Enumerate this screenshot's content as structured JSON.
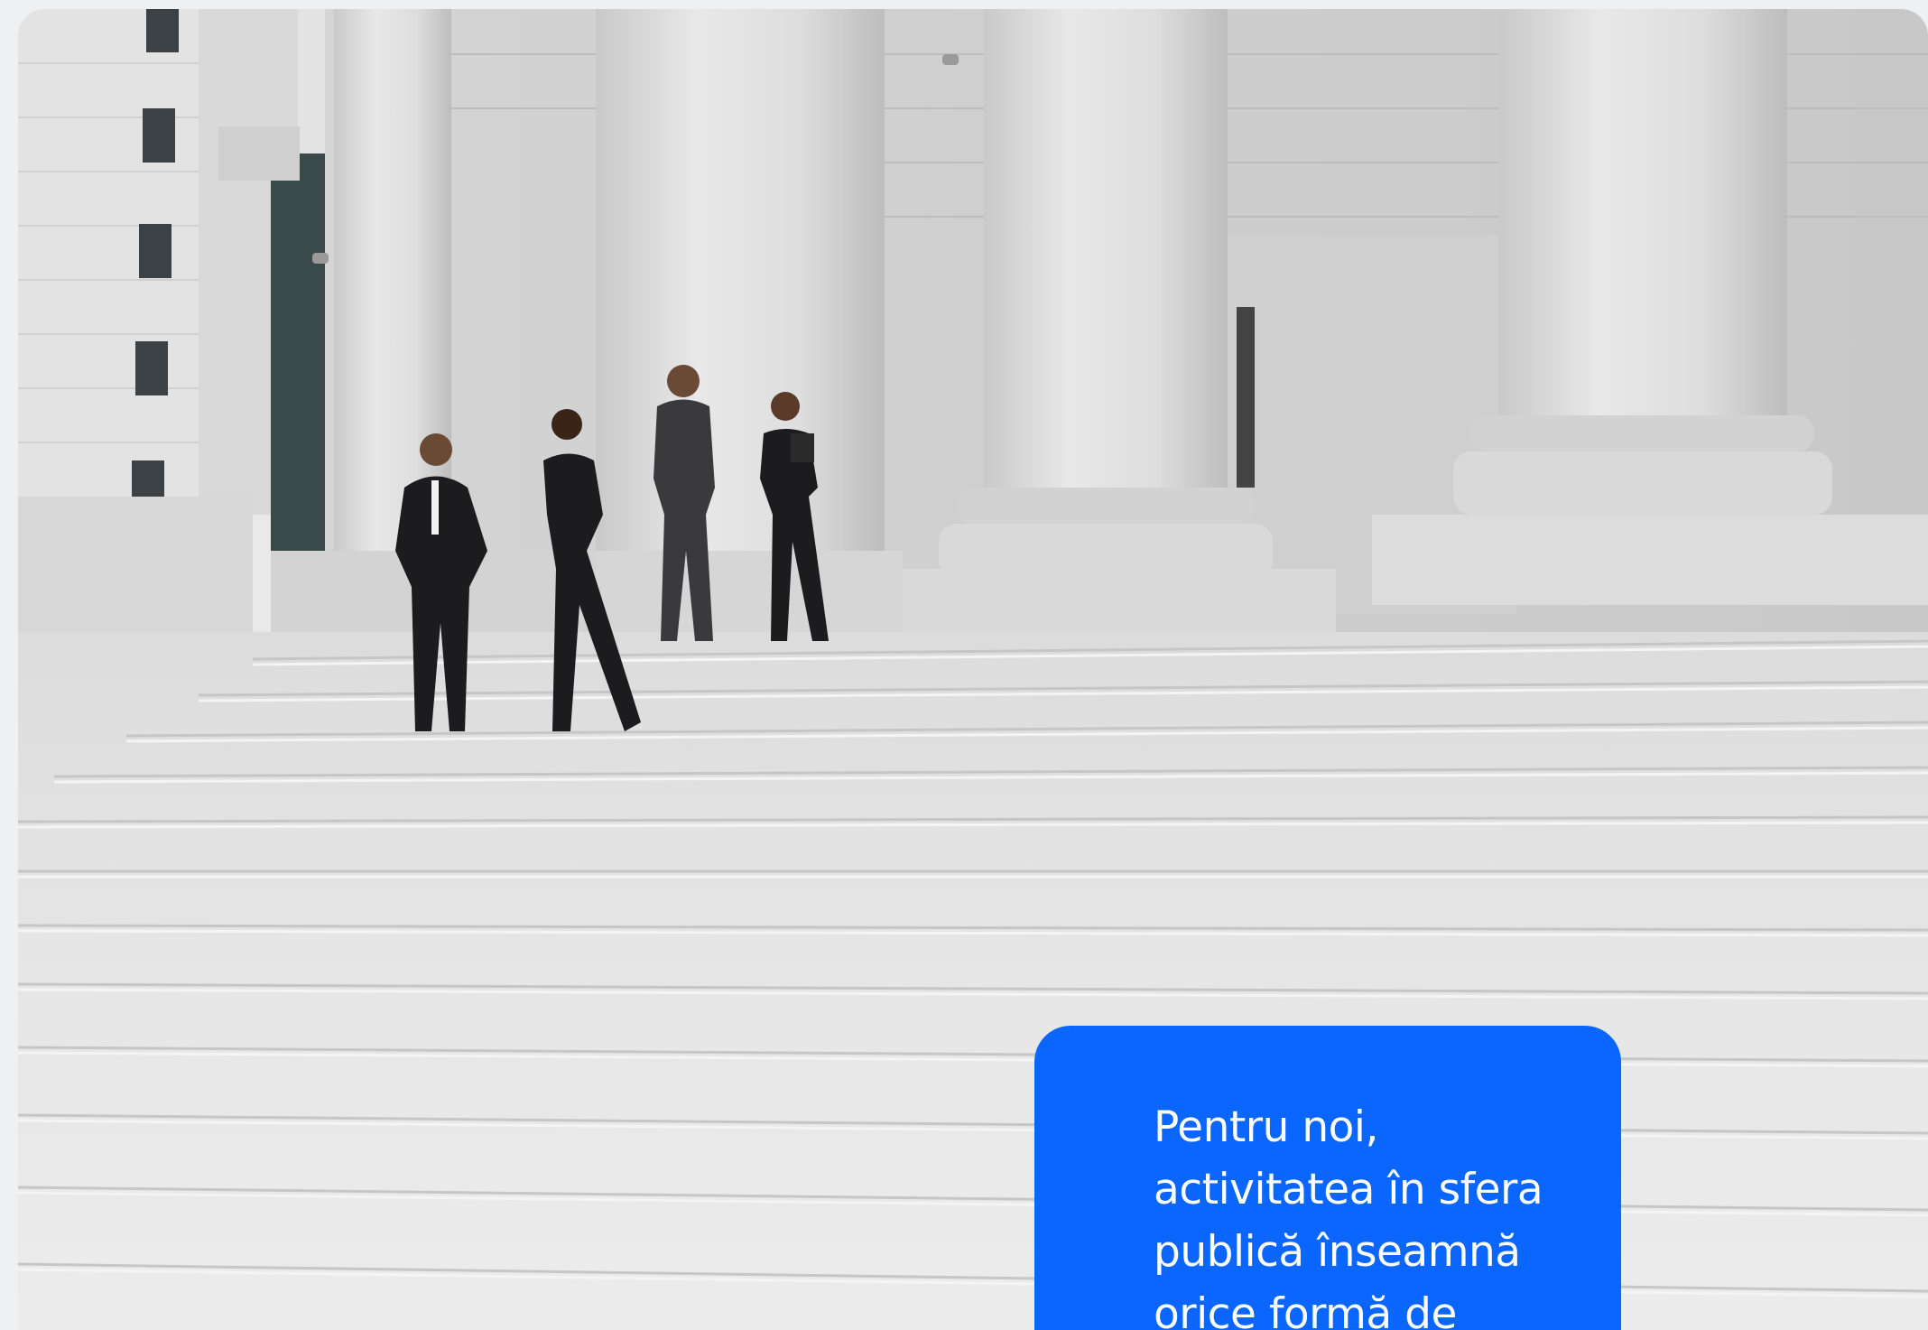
{
  "hero": {
    "image_subject": "four business people in suits talking on the granite steps of a columned courthouse",
    "quote": "Pentru noi, activitatea în sfera publică înseamnă orice formă de"
  },
  "colors": {
    "page_background": "#eef0f2",
    "quote_box": "#0a66fe",
    "quote_text": "#ffffff"
  }
}
